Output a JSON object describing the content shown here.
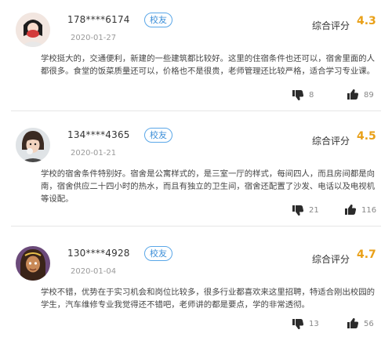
{
  "badge_label": "校友",
  "score_label": "综合评分",
  "colors": {
    "accent": "#3b8ed8",
    "score": "#e9a018",
    "icon": "#2b2b2b"
  },
  "reviews": [
    {
      "user": "178****6174",
      "date": "2020-01-27",
      "score": "4.3",
      "text": "学校挺大的，交通便利，新建的一些建筑都比较好。这里的住宿条件也还可以，宿舍里面的人都很多。食堂的饭菜质量还可以，价格也不是很贵，老师管理还比较严格，适合学习专业课。",
      "dislikes": "8",
      "likes": "89"
    },
    {
      "user": "134****4365",
      "date": "2020-01-21",
      "score": "4.5",
      "text": "学校的宿舍条件特别好。宿舍是公寓样式的，是三室一厅的样式，每间四人，而且房间都是向南，宿舍供应二十四小时的热水，而且有独立的卫生间，宿舍还配置了沙发、电话以及电视机等设配。",
      "dislikes": "21",
      "likes": "116"
    },
    {
      "user": "130****4928",
      "date": "2020-01-04",
      "score": "4.7",
      "text": "学校不错，优势在于实习机会和岗位比较多，很多行业都喜欢来这里招聘，特适合刚出校园的学生，汽车维修专业我觉得还不错吧，老师讲的都是要点，学的非常透彻。",
      "dislikes": "13",
      "likes": "56"
    }
  ]
}
